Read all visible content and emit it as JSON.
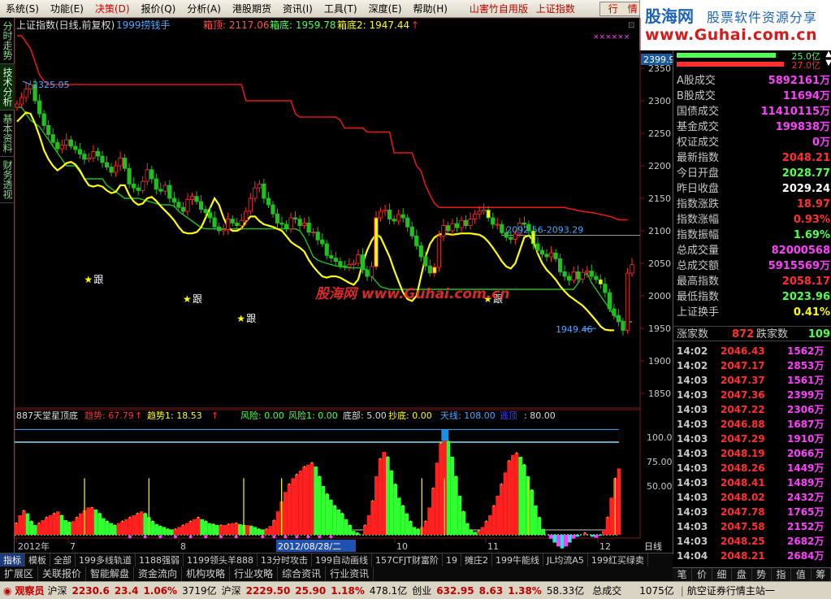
{
  "menu": {
    "items": [
      "系统(S)",
      "功能(E)",
      "决策(D)",
      "报价(Q)",
      "分析(A)",
      "港股期货",
      "资讯(I)",
      "工具(T)",
      "深度(E)",
      "帮助(H)"
    ],
    "brand": [
      "山害竹自用版",
      "上证指数"
    ],
    "quote_button": "行　情"
  },
  "logo": {
    "name": "股海网",
    "tagline": "股票软件资源分享",
    "url": "www.Guhai.com.cn"
  },
  "left_tabs": [
    "分时走势",
    "技术分析",
    "基本资料",
    "财务透视"
  ],
  "header": {
    "title": "上证指数(日线,前复权)",
    "indicator": "1999捞钱手",
    "params": [
      {
        "label": "箱顶: 2117.06",
        "color": "#ff5050"
      },
      {
        "label": "箱底: 1959.78",
        "color": "#50ff50"
      },
      {
        "label": "箱底2: 1947.44",
        "color": "#ffff00"
      }
    ],
    "arrow": "↑",
    "corner_label": "××××××"
  },
  "price_axis": {
    "labels": [
      "2350",
      "2300",
      "2250",
      "2200",
      "2150",
      "2100",
      "2050",
      "2000",
      "1950",
      "1900",
      "1850"
    ],
    "current": "2399.9"
  },
  "annotations": {
    "high": "2325.05",
    "range": "2092.56-2093.29",
    "low": "1949.46",
    "gen": "跟",
    "watermark": "股海网 www.Guhai.com.cn"
  },
  "sub_header": {
    "title": "887天堂星顶底",
    "items": [
      {
        "label": "趋势: 67.79",
        "color": "#ff3030"
      },
      {
        "label": "趋势1: 18.53",
        "color": "#ffff00"
      },
      {
        "label": "风险: 0.00",
        "color": "#50ff50"
      },
      {
        "label": "风险1: 0.00",
        "color": "#50ff50"
      },
      {
        "label": "底部: 5.00",
        "color": "#dddddd"
      },
      {
        "label": "抄底: 0.00",
        "color": "#ffff00"
      },
      {
        "label": "天线: 108.00",
        "color": "#4aa8ff"
      },
      {
        "label": "逃顶",
        "color": "#4040ff"
      },
      {
        "label": ": 80.00",
        "color": "#dddddd"
      }
    ]
  },
  "sub_axis": {
    "labels": [
      "100.0",
      "75.00",
      "50.00"
    ]
  },
  "date_axis": {
    "labels": [
      "2012年",
      "7",
      "8",
      "9",
      "10",
      "11",
      "12"
    ],
    "selected": "2012/08/28/二",
    "period": "日线"
  },
  "right": {
    "flows": [
      {
        "value": "25.0亿",
        "color": "#50ff50"
      },
      {
        "value": "27.0亿",
        "color": "#ff3030"
      }
    ],
    "stats": [
      {
        "label": "A股成交",
        "value": "5892161万",
        "color": "#ff40ff"
      },
      {
        "label": "B股成交",
        "value": "11694万",
        "color": "#ff40ff"
      },
      {
        "label": "国债成交",
        "value": "11410115万",
        "color": "#ff40ff"
      },
      {
        "label": "基金成交",
        "value": "199838万",
        "color": "#ff40ff"
      },
      {
        "label": "权证成交",
        "value": "0万",
        "color": "#ff40ff"
      },
      {
        "label": "最新指数",
        "value": "2048.21",
        "color": "#ff3030"
      },
      {
        "label": "今日开盘",
        "value": "2028.77",
        "color": "#50ff50"
      },
      {
        "label": "昨日收盘",
        "value": "2029.24",
        "color": "#ffffff"
      },
      {
        "label": "指数涨跌",
        "value": "18.97",
        "color": "#ff3030"
      },
      {
        "label": "指数涨幅",
        "value": "0.93%",
        "color": "#ff3030"
      },
      {
        "label": "指数振幅",
        "value": "1.69%",
        "color": "#50ff50"
      },
      {
        "label": "总成交量",
        "value": "82000568",
        "color": "#ff40ff"
      },
      {
        "label": "总成交额",
        "value": "5915569万",
        "color": "#ff40ff"
      },
      {
        "label": "最高指数",
        "value": "2058.17",
        "color": "#ff3030"
      },
      {
        "label": "最低指数",
        "value": "2023.96",
        "color": "#50ff50"
      },
      {
        "label": "上证换手",
        "value": "0.41%",
        "color": "#ffff00"
      }
    ],
    "breadth": {
      "up_label": "涨家数",
      "up": "872",
      "down_label": "跌家数",
      "down": "109"
    },
    "ticks": [
      {
        "time": "14:02",
        "price": "2046.43",
        "vol": "1562万"
      },
      {
        "time": "14:02",
        "price": "2047.17",
        "vol": "2853万"
      },
      {
        "time": "14:03",
        "price": "2047.37",
        "vol": "1561万"
      },
      {
        "time": "14:03",
        "price": "2047.36",
        "vol": "2399万"
      },
      {
        "time": "14:03",
        "price": "2047.22",
        "vol": "2306万"
      },
      {
        "time": "14:03",
        "price": "2046.88",
        "vol": "1687万"
      },
      {
        "time": "14:03",
        "price": "2047.29",
        "vol": "1910万"
      },
      {
        "time": "14:03",
        "price": "2048.19",
        "vol": "2066万"
      },
      {
        "time": "14:03",
        "price": "2048.26",
        "vol": "1449万"
      },
      {
        "time": "14:03",
        "price": "2048.41",
        "vol": "1489万"
      },
      {
        "time": "14:03",
        "price": "2048.02",
        "vol": "2432万"
      },
      {
        "time": "14:03",
        "price": "2047.78",
        "vol": "1765万"
      },
      {
        "time": "14:03",
        "price": "2047.58",
        "vol": "2152万"
      },
      {
        "time": "14:03",
        "price": "2048.25",
        "vol": "2682万"
      },
      {
        "time": "14:04",
        "price": "2048.21",
        "vol": "2684万"
      }
    ],
    "tabs": [
      "笔",
      "价",
      "细",
      "盘",
      "势",
      "指",
      "值",
      "筹"
    ]
  },
  "formula_bar": [
    "指标",
    "模板",
    "全部",
    "199多线轨道",
    "1188强弱",
    "1199领头羊888",
    "13分时攻击",
    "199自动画线",
    "157CFJT财富阶",
    "19",
    "摊庄2",
    "199牛能线",
    "JL均流A5",
    "199红买绿卖"
  ],
  "func_bar": [
    "扩展区",
    "关联报价",
    "智能解盘",
    "资金流向",
    "机构攻略",
    "行业攻略",
    "综合资讯",
    "行业资讯"
  ],
  "status_bar": {
    "app": "观察员",
    "items": [
      {
        "name": "沪深",
        "price": "2230.6",
        "chg": "23.4",
        "pct": "1.06%",
        "amt": "3719亿"
      },
      {
        "name": "沪深",
        "price": "2229.50",
        "chg": "25.90",
        "pct": "1.18%",
        "amt": "478.1亿"
      },
      {
        "name": "创业",
        "price": "632.95",
        "chg": "8.63",
        "pct": "1.38%",
        "amt": "58.33亿"
      }
    ],
    "total_label": "总成交",
    "total": "1075亿",
    "station": "航空证券行情主站一"
  },
  "chart_data": [
    {
      "type": "candlestick",
      "title": "上证指数(日线,前复权)",
      "ylim": [
        1830,
        2400
      ],
      "x_labels": [
        "2012年",
        "7",
        "8",
        "9",
        "10",
        "11",
        "12"
      ],
      "close": [
        2295,
        2305,
        2318,
        2325,
        2300,
        2280,
        2262,
        2248,
        2236,
        2226,
        2232,
        2240,
        2230,
        2225,
        2218,
        2210,
        2212,
        2222,
        2215,
        2205,
        2198,
        2190,
        2200,
        2212,
        2196,
        2172,
        2166,
        2162,
        2176,
        2194,
        2180,
        2164,
        2161,
        2170,
        2150,
        2144,
        2136,
        2130,
        2148,
        2153,
        2145,
        2133,
        2128,
        2120,
        2106,
        2100,
        2102,
        2118,
        2112,
        2108,
        2116,
        2130,
        2150,
        2166,
        2172,
        2150,
        2140,
        2126,
        2112,
        2110,
        2103,
        2120,
        2118,
        2108,
        2112,
        2098,
        2098,
        2086,
        2080,
        2062,
        2058,
        2053,
        2046,
        2045,
        2048,
        2050,
        2063,
        2040,
        2030,
        2045,
        2120,
        2130,
        2132,
        2118,
        2115,
        2125,
        2120,
        2106,
        2092,
        2077,
        2060,
        2046,
        2035,
        2044,
        2092,
        2108,
        2100,
        2111,
        2105,
        2116,
        2108,
        2118,
        2126,
        2130,
        2132,
        2120,
        2110,
        2110,
        2097,
        2090,
        2087,
        2095,
        2112,
        2110,
        2100,
        2080,
        2070,
        2064,
        2060,
        2066,
        2057,
        2037,
        2030,
        2024,
        2037,
        2026,
        2036,
        2038,
        2030,
        2025,
        2018,
        2005,
        1980,
        1970,
        1960,
        1947,
        2035,
        2048
      ],
      "series": [
        {
          "name": "箱顶",
          "values": [
            2400,
            2400,
            2390,
            2380,
            2360,
            2340,
            2330,
            2325,
            2325,
            2325,
            2325,
            2325,
            2325,
            2325,
            2325,
            2325,
            2325,
            2325,
            2325,
            2325,
            2325,
            2325,
            2325,
            2325,
            2325,
            2325,
            2325,
            2325,
            2325,
            2325,
            2325,
            2325,
            2325,
            2325,
            2325,
            2325,
            2325,
            2325,
            2325,
            2325,
            2325,
            2325,
            2325,
            2325,
            2325,
            2325,
            2325,
            2325,
            2325,
            2325,
            2325,
            2300,
            2300,
            2300,
            2300,
            2300,
            2300,
            2300,
            2300,
            2300,
            2300,
            2300,
            2280,
            2275,
            2275,
            2275,
            2275,
            2275,
            2275,
            2275,
            2275,
            2275,
            2270,
            2258,
            2258,
            2258,
            2258,
            2258,
            2252,
            2252,
            2252,
            2252,
            2252,
            2252,
            2220,
            2220,
            2220,
            2220,
            2220,
            2200,
            2192,
            2170,
            2155,
            2142,
            2136,
            2136,
            2136,
            2136,
            2136,
            2136,
            2136,
            2136,
            2136,
            2136,
            2136,
            2136,
            2136,
            2136,
            2136,
            2136,
            2136,
            2136,
            2136,
            2136,
            2136,
            2136,
            2136,
            2136,
            2136,
            2136,
            2136,
            2136,
            2136,
            2134,
            2133,
            2131,
            2130,
            2129,
            2128,
            2127,
            2125,
            2124,
            2122,
            2120,
            2117,
            2117,
            2117
          ]
        },
        {
          "name": "箱底",
          "values": [
            2290,
            2290,
            2280,
            2270,
            2265,
            2260,
            2250,
            2240,
            2230,
            2220,
            2210,
            2200,
            2200,
            2200,
            2190,
            2180,
            2180,
            2180,
            2180,
            2180,
            2170,
            2165,
            2160,
            2155,
            2150,
            2150,
            2150,
            2150,
            2148,
            2146,
            2144,
            2142,
            2140,
            2140,
            2140,
            2138,
            2130,
            2125,
            2120,
            2115,
            2110,
            2105,
            2103,
            2103,
            2103,
            2103,
            2103,
            2103,
            2103,
            2103,
            2103,
            2103,
            2103,
            2103,
            2103,
            2103,
            2103,
            2103,
            2103,
            2103,
            2103,
            2103,
            2103,
            2100,
            2090,
            2075,
            2060,
            2055,
            2052,
            2050,
            2048,
            2046,
            2045,
            2044,
            2043,
            2043,
            2043,
            2043,
            2040,
            2030,
            2022,
            2014,
            2012,
            2010,
            2010,
            2010,
            2010,
            2010,
            2010,
            2010,
            2010,
            2010,
            2010,
            2010,
            2010,
            2010,
            2010,
            2010,
            2010,
            2010,
            2010,
            2010,
            2010,
            2010,
            2010,
            2010,
            2010,
            2010,
            2010,
            2010,
            2010,
            2010,
            2010,
            2010,
            2010,
            2010,
            2010,
            2010,
            2010,
            2010,
            2010,
            2010,
            2010,
            2010,
            2010,
            2020,
            2030,
            2035,
            2020,
            2010,
            2000,
            1990,
            1980,
            1970,
            1965,
            1960,
            1960,
            1960
          ]
        },
        {
          "name": "箱底2",
          "values": [
            2268,
            2275,
            2282,
            2280,
            2265,
            2246,
            2224,
            2210,
            2200,
            2193,
            2198,
            2204,
            2206,
            2202,
            2193,
            2180,
            2170,
            2168,
            2170,
            2168,
            2162,
            2158,
            2160,
            2170,
            2170,
            2155,
            2145,
            2140,
            2142,
            2150,
            2152,
            2146,
            2138,
            2131,
            2124,
            2116,
            2106,
            2098,
            2096,
            2096,
            2098,
            2105,
            2120,
            2135,
            2150,
            2140,
            2120,
            2105,
            2100,
            2100,
            2104,
            2114,
            2122,
            2122,
            2115,
            2110,
            2108,
            2106,
            2103,
            2100,
            2092,
            2083,
            2078,
            2074,
            2068,
            2055,
            2045,
            2037,
            2030,
            2028,
            2030,
            2030,
            2028,
            2024,
            2020,
            2017,
            2025,
            2050,
            2070,
            2085,
            2095,
            2090,
            2075,
            2060,
            2040,
            2022,
            2005,
            1995,
            1992,
            2000,
            2030,
            2060,
            2080,
            2090,
            2094,
            2096,
            2095,
            2094,
            2095,
            2096,
            2096,
            2096,
            2095,
            2094,
            2090,
            2083,
            2074,
            2064,
            2053,
            2045,
            2042,
            2050,
            2070,
            2090,
            2093,
            2085,
            2065,
            2050,
            2040,
            2033,
            2025,
            2015,
            2007,
            2000,
            1995,
            1990,
            1985,
            1978,
            1970,
            1962,
            1953,
            1948,
            1947,
            1947
          ]
        }
      ]
    },
    {
      "type": "bar",
      "title": "887天堂星顶底",
      "ylim": [
        0,
        115
      ],
      "y_labels": [
        "100.0",
        "75.00",
        "50.00"
      ],
      "reference_lines": [
        108,
        80,
        5
      ],
      "series": [
        {
          "name": "趋势",
          "values": [
            12,
            20,
            25,
            22,
            14,
            10,
            12,
            15,
            18,
            20,
            22,
            24,
            20,
            15,
            13,
            14,
            18,
            22,
            25,
            28,
            28,
            26,
            22,
            17,
            14,
            12,
            10,
            12,
            14,
            16,
            18,
            20,
            22,
            24,
            22,
            18,
            14,
            11,
            9,
            8,
            6,
            5,
            6,
            8,
            10,
            12,
            14,
            16,
            18,
            16,
            14,
            12,
            11,
            10,
            10,
            10,
            11,
            12,
            12,
            11,
            10,
            10,
            9,
            8,
            6,
            5,
            6,
            9,
            15,
            24,
            34,
            44,
            52,
            58,
            62,
            66,
            70,
            72,
            74,
            70,
            60,
            50,
            42,
            36,
            30,
            26,
            22,
            16,
            10,
            4,
            2,
            0,
            10,
            20,
            35,
            60,
            78,
            85,
            80,
            66,
            52,
            38,
            30,
            22,
            14,
            8,
            6,
            8,
            14,
            28,
            48,
            74,
            94,
            100,
            96,
            80,
            60,
            40,
            24,
            12,
            5,
            3,
            4,
            8,
            14,
            20,
            30,
            40,
            52,
            64,
            76,
            82,
            84,
            80,
            72,
            60,
            46,
            30,
            18,
            6,
            0,
            -4,
            -8,
            -12,
            -14,
            -12,
            -8,
            -4,
            -2,
            0,
            2,
            0,
            -2,
            -3,
            -1,
            5,
            18,
            38,
            58,
            68
          ]
        }
      ]
    }
  ]
}
